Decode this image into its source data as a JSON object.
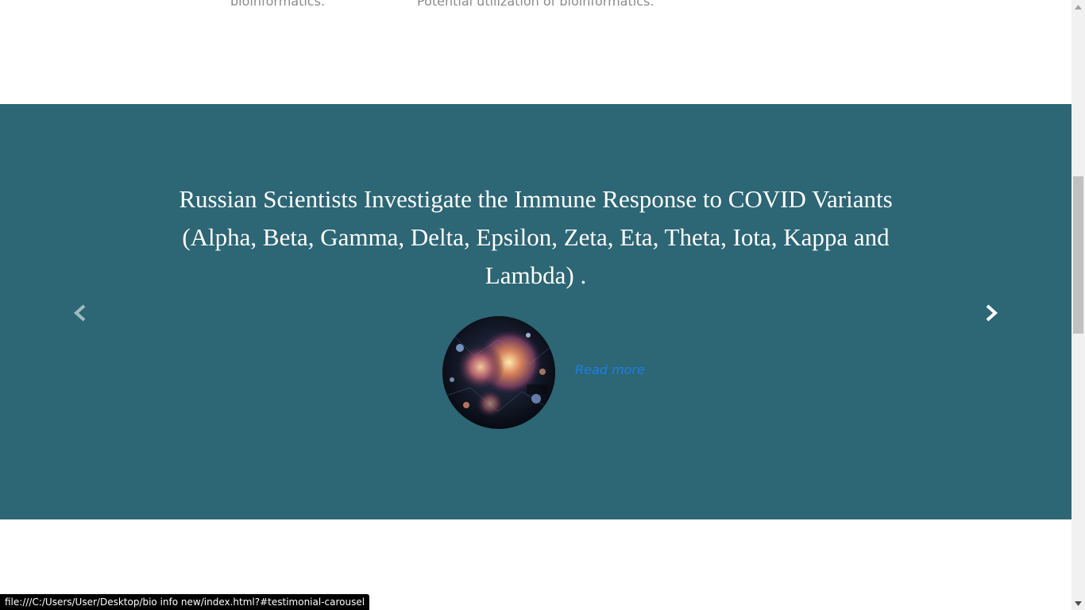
{
  "top_section": {
    "left_text": "bioinformatics.",
    "right_text": "Potential utilization of bioinformatics."
  },
  "carousel": {
    "headline": "Russian Scientists Investigate the Immune Response to COVID Variants (Alpha, Beta, Gamma, Delta, Epsilon, Zeta, Eta, Theta, Iota, Kappa and Lambda) .",
    "read_more_label": "Read more",
    "prev_icon": "chevron-left-icon",
    "next_icon": "chevron-right-icon",
    "background_color": "#2d6674",
    "link_color": "#1e7fe0"
  },
  "status_bar": {
    "url": "file:///C:/Users/User/Desktop/bio info new/index.html?#testimonial-carousel"
  }
}
